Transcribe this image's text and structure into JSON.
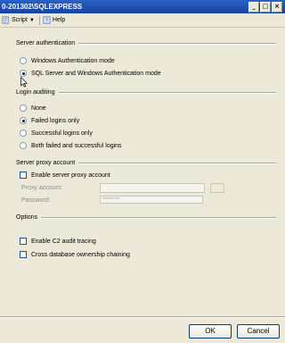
{
  "window": {
    "title": "0-201302\\SQLEXPRESS"
  },
  "toolbar": {
    "script_label": "Script",
    "help_label": "Help"
  },
  "sections": {
    "server_auth": "Server authentication",
    "login_auditing": "Login auditing",
    "proxy": "Server proxy account",
    "options": "Options"
  },
  "auth_options": [
    {
      "label": "Windows Authentication mode",
      "selected": false
    },
    {
      "label": "SQL Server and Windows Authentication mode",
      "selected": true
    }
  ],
  "audit_options": [
    {
      "label": "None",
      "selected": false
    },
    {
      "label": "Failed logins only",
      "selected": true
    },
    {
      "label": "Successful logins only",
      "selected": false
    },
    {
      "label": "Both failed and successful logins",
      "selected": false
    }
  ],
  "proxy": {
    "enable_label": "Enable server proxy account",
    "enabled": false,
    "account_label": "Proxy account:",
    "account_value": "",
    "password_label": "Password:",
    "password_value": "**********"
  },
  "options": {
    "c2_label": "Enable C2 audit tracing",
    "c2_checked": false,
    "cross_db_label": "Cross database ownership chaining",
    "cross_db_checked": false
  },
  "buttons": {
    "ok_label": "OK",
    "cancel_label": "Cancel"
  }
}
